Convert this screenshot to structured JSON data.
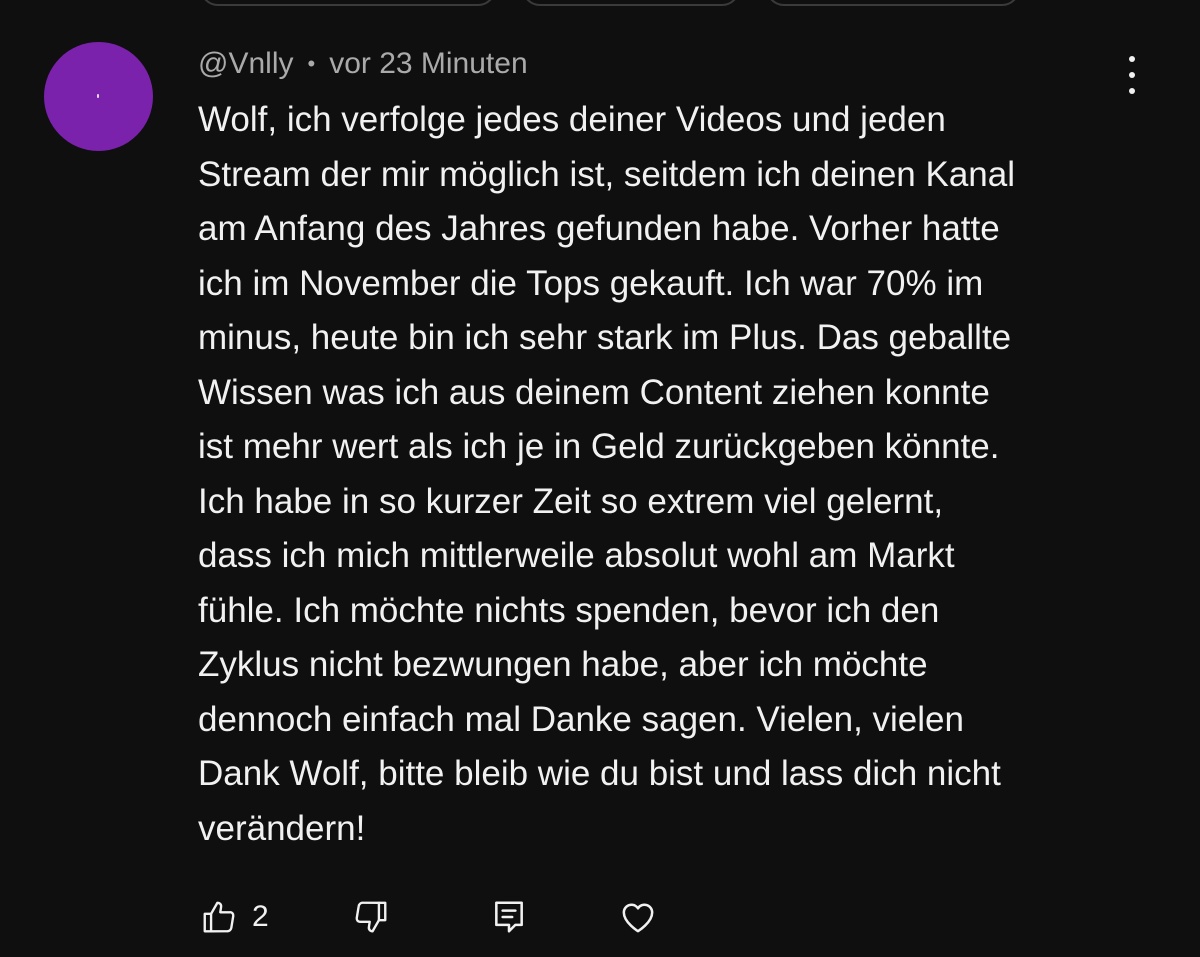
{
  "comment": {
    "author": "@Vnlly",
    "separator": "•",
    "time": "vor 23 Minuten",
    "avatar_color": "#7a22ab",
    "lines": [
      "Wolf, ich verfolge jedes deiner Videos und jeden",
      "Stream der mir möglich ist, seitdem ich deinen Kanal",
      "am Anfang des Jahres gefunden habe. Vorher hatte",
      "ich im November die Tops gekauft. Ich war 70% im",
      "minus, heute bin ich sehr stark im Plus. Das geballte",
      "Wissen was ich aus deinem Content ziehen konnte",
      "ist mehr wert als ich je in Geld zurückgeben könnte.",
      "Ich habe in so kurzer Zeit so extrem viel gelernt,",
      "dass ich mich mittlerweile absolut wohl am Markt",
      "fühle. Ich möchte nichts spenden, bevor ich den",
      "Zyklus nicht bezwungen habe, aber ich möchte",
      "dennoch einfach mal Danke sagen. Vielen, vielen",
      "Dank Wolf, bitte bleib wie du bist und lass dich nicht",
      "verändern!"
    ]
  },
  "actions": {
    "like_count": "2",
    "like_icon": "thumbs-up-icon",
    "dislike_icon": "thumbs-down-icon",
    "reply_icon": "reply-icon",
    "heart_icon": "heart-icon",
    "more_icon": "more-vertical-icon"
  },
  "colors": {
    "background": "#0f0f0f",
    "text": "#f1f1f1",
    "secondary_text": "#aaaaaa"
  }
}
